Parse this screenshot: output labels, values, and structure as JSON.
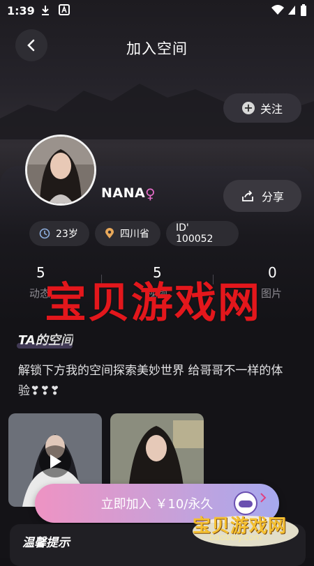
{
  "status_bar": {
    "time": "1:39"
  },
  "header": {
    "title": "加入空间"
  },
  "follow_button": {
    "label": "关注"
  },
  "profile": {
    "name": "NANA",
    "gender_symbol": "♀",
    "share_label": "分享",
    "chips": {
      "age": "23岁",
      "location": "四川省",
      "id": "ID' 100052"
    }
  },
  "stats": [
    {
      "value": "5",
      "label": "动态"
    },
    {
      "value": "5",
      "label": "视频"
    },
    {
      "value": "0",
      "label": "图片"
    }
  ],
  "space": {
    "title": "TA的空间",
    "description": "解锁下方我的空间探索美妙世界 给哥哥不一样的体验❣❣❣"
  },
  "join_button": {
    "label": "立即加入 ￥10/永久"
  },
  "tips": {
    "title": "温馨提示"
  },
  "watermark": {
    "text": "宝贝游戏网",
    "logo_text": "宝贝游戏网",
    "logo_url": "baobeiy.com"
  },
  "colors": {
    "accent_pink": "#ee93c3",
    "accent_purple": "#a6a9ef",
    "watermark_red": "#e3171c"
  }
}
